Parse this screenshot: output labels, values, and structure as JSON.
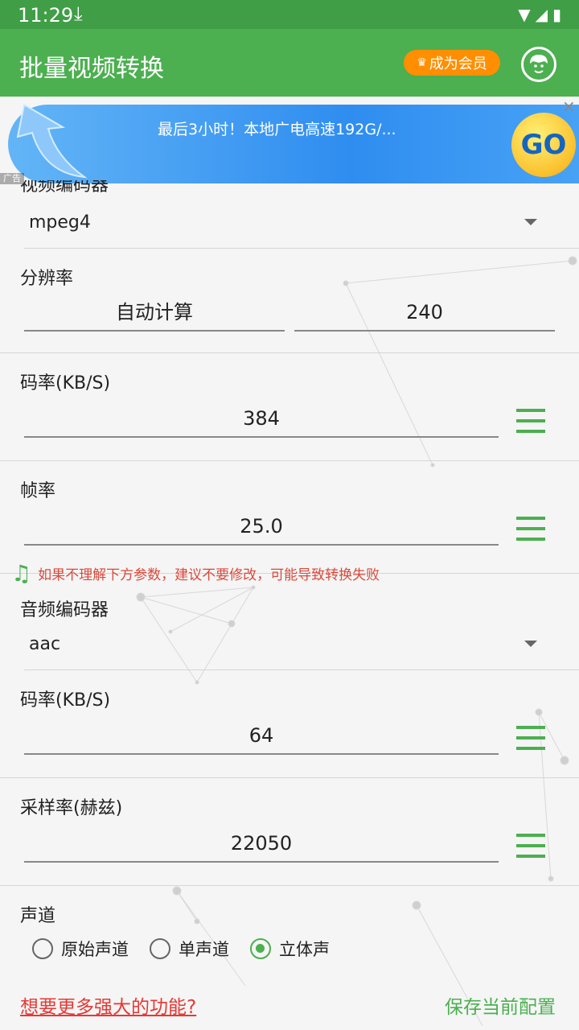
{
  "status": {
    "time": "11:29",
    "download_icon": "download-icon",
    "icons": "wifi signal battery"
  },
  "appbar": {
    "title": "批量视频转换",
    "vip_label": "成为会员"
  },
  "ad": {
    "text": "最后3小时！本地广电高速192G/...",
    "go_label": "GO",
    "close": "×",
    "tag": "广告"
  },
  "video_codec": {
    "label": "视频编码器",
    "value": "mpeg4"
  },
  "resolution": {
    "label": "分辨率",
    "width_value": "自动计算",
    "height_value": "240"
  },
  "video_bitrate": {
    "label": "码率(KB/S)",
    "value": "384"
  },
  "framerate": {
    "label": "帧率",
    "value": "25.0"
  },
  "warning": {
    "text": "如果不理解下方参数，建议不要修改，可能导致转换失败"
  },
  "audio_codec": {
    "label": "音频编码器",
    "value": "aac"
  },
  "audio_bitrate": {
    "label": "码率(KB/S)",
    "value": "64"
  },
  "samplerate": {
    "label": "采样率(赫兹)",
    "value": "22050"
  },
  "channel": {
    "label": "声道",
    "options": [
      "原始声道",
      "单声道",
      "立体声"
    ],
    "selected": "立体声"
  },
  "footer": {
    "more_link": "想要更多强大的功能?",
    "save_link": "保存当前配置"
  },
  "colors": {
    "primary": "#4caf50",
    "accent": "#ff8f00",
    "warning": "#d84a3c"
  }
}
